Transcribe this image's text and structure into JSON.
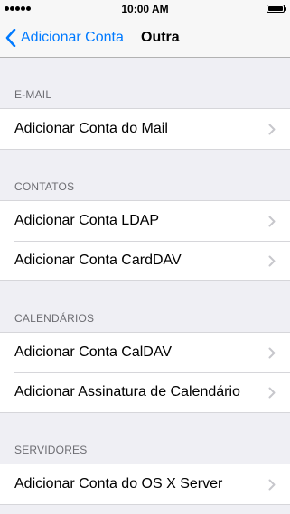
{
  "status_bar": {
    "time": "10:00 AM"
  },
  "nav": {
    "back_label": "Adicionar Conta",
    "title": "Outra"
  },
  "sections": [
    {
      "header": "E-MAIL",
      "items": [
        "Adicionar Conta do Mail"
      ]
    },
    {
      "header": "CONTATOS",
      "items": [
        "Adicionar Conta LDAP",
        "Adicionar Conta CardDAV"
      ]
    },
    {
      "header": "CALENDÁRIOS",
      "items": [
        "Adicionar Conta CalDAV",
        "Adicionar Assinatura de Calendário"
      ]
    },
    {
      "header": "SERVIDORES",
      "items": [
        "Adicionar Conta do OS X Server"
      ]
    }
  ],
  "icons": {
    "back": "chevron-left-icon",
    "disclosure": "chevron-right-icon"
  },
  "colors": {
    "accent": "#007aff",
    "background": "#efeff4",
    "chevron": "#c7c7cc"
  }
}
